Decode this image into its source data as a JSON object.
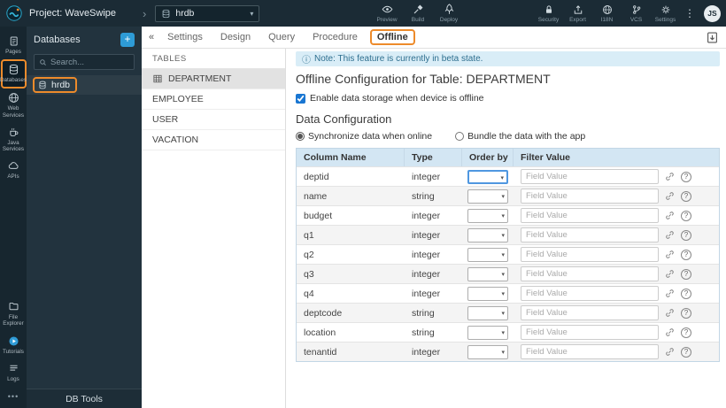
{
  "colors": {
    "annotation": "#ed8b2b",
    "topbar": "#1b2b35",
    "info_bg": "#d9edf7",
    "table_header_bg": "#d3e6f3",
    "accent_blue": "#2e9bd6"
  },
  "icons": {
    "caret": "▾",
    "chevron": "›",
    "info": "ⓘ",
    "kebab": "⋮",
    "collapse": "«",
    "more": "•••",
    "question": "?",
    "plus": "+"
  },
  "topbar": {
    "project_label": "Project: WaveSwipe",
    "db_selector_value": "hrdb",
    "center_actions": [
      {
        "label": "Preview"
      },
      {
        "label": "Build"
      },
      {
        "label": "Deploy"
      }
    ],
    "right_actions": [
      {
        "label": "Security"
      },
      {
        "label": "Export"
      },
      {
        "label": "I18N"
      },
      {
        "label": "VCS"
      },
      {
        "label": "Settings"
      }
    ],
    "avatar": "JS"
  },
  "rail": {
    "items": [
      "Pages",
      "Databases",
      "Web Services",
      "Java Services",
      "APIs",
      "File Explorer",
      "Tutorials",
      "Logs"
    ]
  },
  "db_panel": {
    "title": "Databases",
    "search_placeholder": "Search...",
    "items": [
      "hrdb"
    ],
    "footer": "DB Tools"
  },
  "main": {
    "tabs": [
      "Settings",
      "Design",
      "Query",
      "Procedure",
      "Offline"
    ],
    "active_tab": "Offline"
  },
  "tables_panel": {
    "title": "TABLES",
    "items": [
      "DEPARTMENT",
      "EMPLOYEE",
      "USER",
      "VACATION"
    ],
    "selected": "DEPARTMENT"
  },
  "content": {
    "note": "Note: This feature is currently in beta state.",
    "title": "Offline Configuration for Table: DEPARTMENT",
    "enable_checkbox_label": "Enable data storage when device is offline",
    "enable_checkbox_checked": true,
    "section_title": "Data Configuration",
    "radio_options": [
      "Synchronize data when online",
      "Bundle the data with the app"
    ],
    "selected_radio": "Synchronize data when online",
    "table": {
      "headers": [
        "Column Name",
        "Type",
        "Order by",
        "Filter Value"
      ],
      "filter_placeholder": "Field Value",
      "rows": [
        {
          "name": "deptid",
          "type": "integer"
        },
        {
          "name": "name",
          "type": "string"
        },
        {
          "name": "budget",
          "type": "integer"
        },
        {
          "name": "q1",
          "type": "integer"
        },
        {
          "name": "q2",
          "type": "integer"
        },
        {
          "name": "q3",
          "type": "integer"
        },
        {
          "name": "q4",
          "type": "integer"
        },
        {
          "name": "deptcode",
          "type": "string"
        },
        {
          "name": "location",
          "type": "string"
        },
        {
          "name": "tenantid",
          "type": "integer"
        }
      ]
    }
  }
}
